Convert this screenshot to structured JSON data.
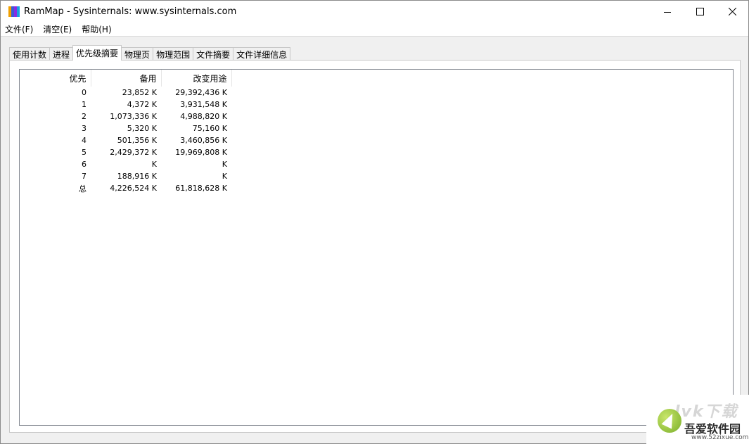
{
  "window": {
    "title": "RamMap - Sysinternals: www.sysinternals.com",
    "icon_colors": [
      "#f0a000",
      "#3a5bd6",
      "#8a2be2",
      "#18a0e0"
    ]
  },
  "menu": {
    "items": [
      "文件(F)",
      "清空(E)",
      "帮助(H)"
    ]
  },
  "tabs": {
    "items": [
      "使用计数",
      "进程",
      "优先级摘要",
      "物理页",
      "物理范围",
      "文件摘要",
      "文件详细信息"
    ],
    "active": "优先级摘要"
  },
  "table": {
    "headers": [
      "优先",
      "备用",
      "改变用途"
    ],
    "rows": [
      [
        "0",
        "23,852 K",
        "29,392,436 K"
      ],
      [
        "1",
        "4,372 K",
        "3,931,548 K"
      ],
      [
        "2",
        "1,073,336 K",
        "4,988,820 K"
      ],
      [
        "3",
        "5,320 K",
        "75,160 K"
      ],
      [
        "4",
        "501,356 K",
        "3,460,856 K"
      ],
      [
        "5",
        "2,429,372 K",
        "19,969,808 K"
      ],
      [
        "6",
        "K",
        "K"
      ],
      [
        "7",
        "188,916 K",
        "K"
      ],
      [
        "总",
        "4,226,524 K",
        "61,818,628 K"
      ]
    ]
  },
  "watermark": {
    "top": "lvk下载",
    "brand": "吾爱软件园",
    "url": "www.52zixue.com"
  }
}
